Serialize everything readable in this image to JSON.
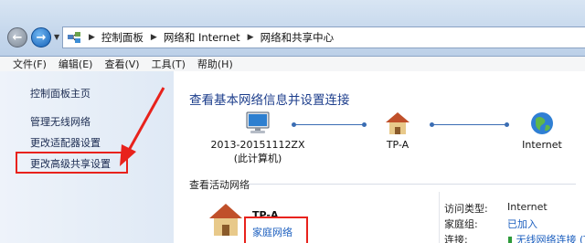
{
  "address": {
    "breadcrumbs": [
      "控制面板",
      "网络和 Internet",
      "网络和共享中心"
    ]
  },
  "menu": [
    "文件(F)",
    "编辑(E)",
    "查看(V)",
    "工具(T)",
    "帮助(H)"
  ],
  "sidebar": {
    "home": "控制面板主页",
    "links": [
      "管理无线网络",
      "更改适配器设置",
      "更改高级共享设置"
    ]
  },
  "main": {
    "title": "查看基本网络信息并设置连接",
    "map": {
      "computer_name": "2013-20151112ZX",
      "computer_sub": "(此计算机)",
      "router": "TP-A",
      "internet": "Internet"
    },
    "active_title": "查看活动网络",
    "active": {
      "network_name": "TP-A",
      "network_type": "家庭网络",
      "access_type_label": "访问类型:",
      "access_type_value": "Internet",
      "homegroup_label": "家庭组:",
      "homegroup_value": "已加入",
      "connection_label": "连接:",
      "connection_value": "无线网络连接 (TP"
    }
  },
  "colors": {
    "title_blue": "#1d3e8c",
    "link_blue": "#1c5fbf",
    "annotation_red": "#e8221c"
  }
}
